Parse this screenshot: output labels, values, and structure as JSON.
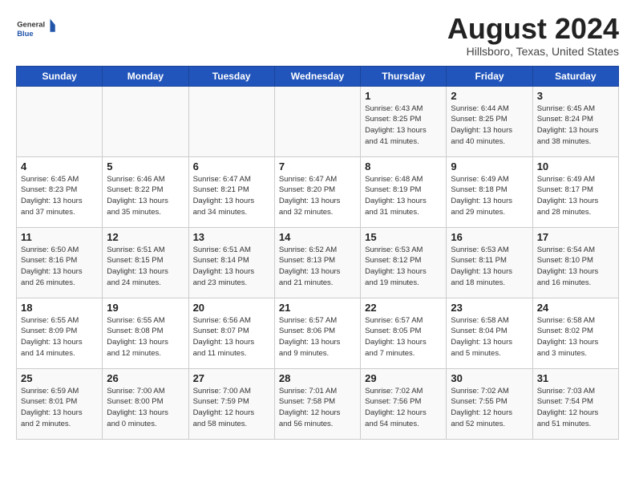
{
  "header": {
    "logo_line1": "General",
    "logo_line2": "Blue",
    "month_year": "August 2024",
    "location": "Hillsboro, Texas, United States"
  },
  "days_of_week": [
    "Sunday",
    "Monday",
    "Tuesday",
    "Wednesday",
    "Thursday",
    "Friday",
    "Saturday"
  ],
  "weeks": [
    [
      {
        "day": "",
        "info": ""
      },
      {
        "day": "",
        "info": ""
      },
      {
        "day": "",
        "info": ""
      },
      {
        "day": "",
        "info": ""
      },
      {
        "day": "1",
        "info": "Sunrise: 6:43 AM\nSunset: 8:25 PM\nDaylight: 13 hours\nand 41 minutes."
      },
      {
        "day": "2",
        "info": "Sunrise: 6:44 AM\nSunset: 8:25 PM\nDaylight: 13 hours\nand 40 minutes."
      },
      {
        "day": "3",
        "info": "Sunrise: 6:45 AM\nSunset: 8:24 PM\nDaylight: 13 hours\nand 38 minutes."
      }
    ],
    [
      {
        "day": "4",
        "info": "Sunrise: 6:45 AM\nSunset: 8:23 PM\nDaylight: 13 hours\nand 37 minutes."
      },
      {
        "day": "5",
        "info": "Sunrise: 6:46 AM\nSunset: 8:22 PM\nDaylight: 13 hours\nand 35 minutes."
      },
      {
        "day": "6",
        "info": "Sunrise: 6:47 AM\nSunset: 8:21 PM\nDaylight: 13 hours\nand 34 minutes."
      },
      {
        "day": "7",
        "info": "Sunrise: 6:47 AM\nSunset: 8:20 PM\nDaylight: 13 hours\nand 32 minutes."
      },
      {
        "day": "8",
        "info": "Sunrise: 6:48 AM\nSunset: 8:19 PM\nDaylight: 13 hours\nand 31 minutes."
      },
      {
        "day": "9",
        "info": "Sunrise: 6:49 AM\nSunset: 8:18 PM\nDaylight: 13 hours\nand 29 minutes."
      },
      {
        "day": "10",
        "info": "Sunrise: 6:49 AM\nSunset: 8:17 PM\nDaylight: 13 hours\nand 28 minutes."
      }
    ],
    [
      {
        "day": "11",
        "info": "Sunrise: 6:50 AM\nSunset: 8:16 PM\nDaylight: 13 hours\nand 26 minutes."
      },
      {
        "day": "12",
        "info": "Sunrise: 6:51 AM\nSunset: 8:15 PM\nDaylight: 13 hours\nand 24 minutes."
      },
      {
        "day": "13",
        "info": "Sunrise: 6:51 AM\nSunset: 8:14 PM\nDaylight: 13 hours\nand 23 minutes."
      },
      {
        "day": "14",
        "info": "Sunrise: 6:52 AM\nSunset: 8:13 PM\nDaylight: 13 hours\nand 21 minutes."
      },
      {
        "day": "15",
        "info": "Sunrise: 6:53 AM\nSunset: 8:12 PM\nDaylight: 13 hours\nand 19 minutes."
      },
      {
        "day": "16",
        "info": "Sunrise: 6:53 AM\nSunset: 8:11 PM\nDaylight: 13 hours\nand 18 minutes."
      },
      {
        "day": "17",
        "info": "Sunrise: 6:54 AM\nSunset: 8:10 PM\nDaylight: 13 hours\nand 16 minutes."
      }
    ],
    [
      {
        "day": "18",
        "info": "Sunrise: 6:55 AM\nSunset: 8:09 PM\nDaylight: 13 hours\nand 14 minutes."
      },
      {
        "day": "19",
        "info": "Sunrise: 6:55 AM\nSunset: 8:08 PM\nDaylight: 13 hours\nand 12 minutes."
      },
      {
        "day": "20",
        "info": "Sunrise: 6:56 AM\nSunset: 8:07 PM\nDaylight: 13 hours\nand 11 minutes."
      },
      {
        "day": "21",
        "info": "Sunrise: 6:57 AM\nSunset: 8:06 PM\nDaylight: 13 hours\nand 9 minutes."
      },
      {
        "day": "22",
        "info": "Sunrise: 6:57 AM\nSunset: 8:05 PM\nDaylight: 13 hours\nand 7 minutes."
      },
      {
        "day": "23",
        "info": "Sunrise: 6:58 AM\nSunset: 8:04 PM\nDaylight: 13 hours\nand 5 minutes."
      },
      {
        "day": "24",
        "info": "Sunrise: 6:58 AM\nSunset: 8:02 PM\nDaylight: 13 hours\nand 3 minutes."
      }
    ],
    [
      {
        "day": "25",
        "info": "Sunrise: 6:59 AM\nSunset: 8:01 PM\nDaylight: 13 hours\nand 2 minutes."
      },
      {
        "day": "26",
        "info": "Sunrise: 7:00 AM\nSunset: 8:00 PM\nDaylight: 13 hours\nand 0 minutes."
      },
      {
        "day": "27",
        "info": "Sunrise: 7:00 AM\nSunset: 7:59 PM\nDaylight: 12 hours\nand 58 minutes."
      },
      {
        "day": "28",
        "info": "Sunrise: 7:01 AM\nSunset: 7:58 PM\nDaylight: 12 hours\nand 56 minutes."
      },
      {
        "day": "29",
        "info": "Sunrise: 7:02 AM\nSunset: 7:56 PM\nDaylight: 12 hours\nand 54 minutes."
      },
      {
        "day": "30",
        "info": "Sunrise: 7:02 AM\nSunset: 7:55 PM\nDaylight: 12 hours\nand 52 minutes."
      },
      {
        "day": "31",
        "info": "Sunrise: 7:03 AM\nSunset: 7:54 PM\nDaylight: 12 hours\nand 51 minutes."
      }
    ]
  ]
}
